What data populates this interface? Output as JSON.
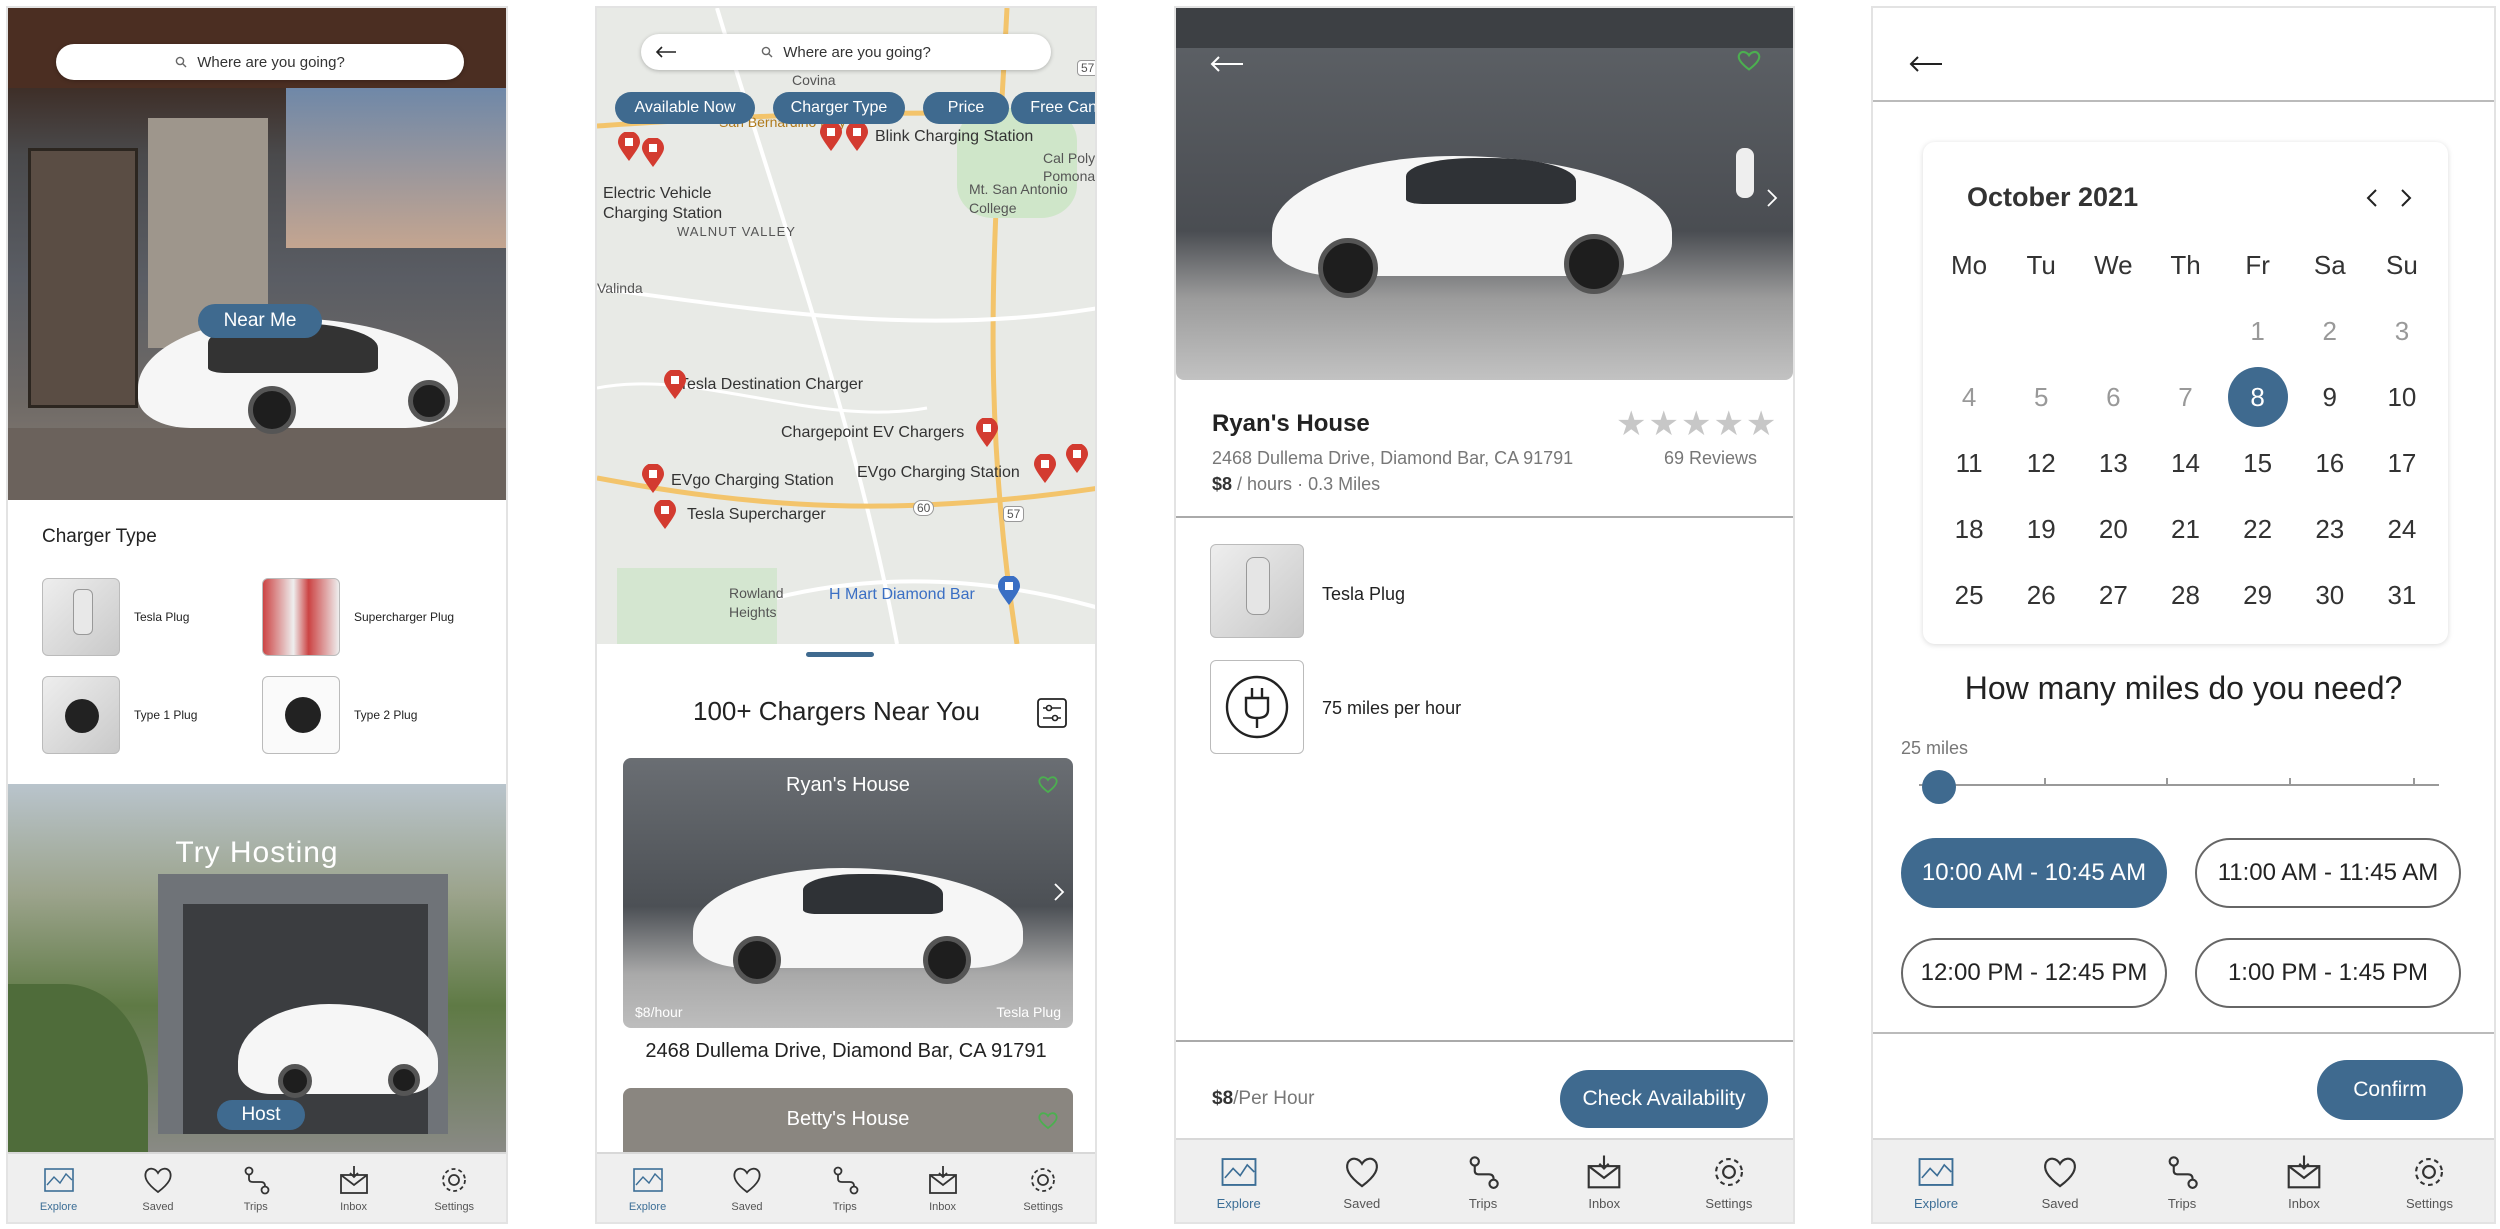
{
  "screen1": {
    "search_placeholder": "Where are you going?",
    "near_me_label": "Near Me",
    "charger_type_title": "Charger Type",
    "charger_types": [
      "Tesla Plug",
      "Supercharger Plug",
      "Type 1 Plug",
      "Type 2 Plug"
    ],
    "hosting_title": "Try Hosting",
    "host_button": "Host"
  },
  "screen2": {
    "search_placeholder": "Where are you going?",
    "filters": [
      "Available Now",
      "Charger Type",
      "Price",
      "Free Cancellation"
    ],
    "map_labels": {
      "covina": "Covina",
      "san_bernardino": "San Bernardino Fwy",
      "blink": "Blink Charging Station",
      "cal_poly": "Cal Poly",
      "pomona": "Pomona",
      "ev_station": "Electric Vehicle Charging Station",
      "walnut_valley": "WALNUT VALLEY",
      "mt_san_antonio": "Mt. San Antonio College",
      "valinda": "Valinda",
      "tesla_dest": "Tesla Destination Charger",
      "chargepoint": "Chargepoint EV Chargers",
      "evgo_1": "EVgo Charging Station",
      "evgo_2": "EVgo Charging Station",
      "tesla_super": "Tesla Supercharger",
      "rowland_heights": "Rowland Heights",
      "hmart": "H Mart Diamond Bar",
      "road_60": "60",
      "road_57a": "57",
      "road_57b": "57"
    },
    "list_title": "100+ Chargers Near You",
    "cards": [
      {
        "name": "Ryan's House",
        "price": "$8/hour",
        "plug": "Tesla Plug",
        "address": "2468 Dullema Drive, Diamond Bar, CA 91791"
      },
      {
        "name": "Betty's House"
      }
    ]
  },
  "screen3": {
    "name": "Ryan's House",
    "address": "2468 Dullema Drive, Diamond Bar, CA 91791",
    "price_bold": "$8",
    "price_unit": " / hours",
    "distance": "0.3 Miles",
    "rating": 0,
    "reviews": "69 Reviews",
    "features": [
      "Tesla Plug",
      "75 miles per hour"
    ],
    "footer_price_bold": "$8",
    "footer_price_unit": "/Per Hour",
    "check_button": "Check Availability"
  },
  "screen4": {
    "month": "October 2021",
    "weekdays": [
      "Mo",
      "Tu",
      "We",
      "Th",
      "Fr",
      "Sa",
      "Su"
    ],
    "selected_day": 8,
    "miles_question": "How many miles do you need?",
    "miles_value": "25 miles",
    "slider_fraction": 0.0,
    "slots": [
      "10:00 AM - 10:45 AM",
      "11:00 AM - 11:45 AM",
      "12:00 PM - 12:45 PM",
      "1:00 PM - 1:45 PM"
    ],
    "selected_slot": 0,
    "confirm_button": "Confirm"
  },
  "tabs": [
    "Explore",
    "Saved",
    "Trips",
    "Inbox",
    "Settings"
  ],
  "colors": {
    "accent": "#3f6a8f",
    "heart": "#4caf50"
  }
}
